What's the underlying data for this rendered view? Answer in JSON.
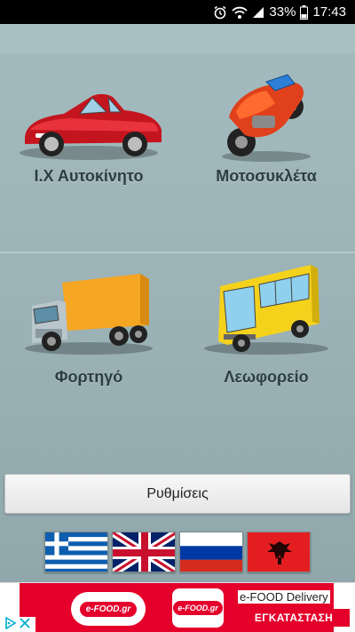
{
  "status_bar": {
    "battery_percent": "33%",
    "time": "17:43",
    "icons": [
      "alarm-icon",
      "wifi-icon",
      "signal-icon",
      "battery-icon"
    ]
  },
  "vehicles": [
    {
      "label": "Ι.Χ Αυτοκίνητο",
      "icon": "car-icon",
      "color": "#d61f2c"
    },
    {
      "label": "Μοτοσυκλέτα",
      "icon": "motorcycle-icon",
      "color": "#e24a1c"
    },
    {
      "label": "Φορτηγό",
      "icon": "truck-icon",
      "color": "#f5a623"
    },
    {
      "label": "Λεωφορείο",
      "icon": "bus-icon",
      "color": "#f4d21c"
    }
  ],
  "settings_label": "Ρυθμίσεις",
  "languages": [
    {
      "name": "greek-flag"
    },
    {
      "name": "uk-flag"
    },
    {
      "name": "russian-flag"
    },
    {
      "name": "albanian-flag"
    }
  ],
  "ad": {
    "brand_logo_text": "e-FOOD.gr",
    "title": "e-FOOD Delivery",
    "cta": "ΕΓΚΑΤΑΣΤΑΣΗ",
    "brand_color": "#e4002b"
  }
}
